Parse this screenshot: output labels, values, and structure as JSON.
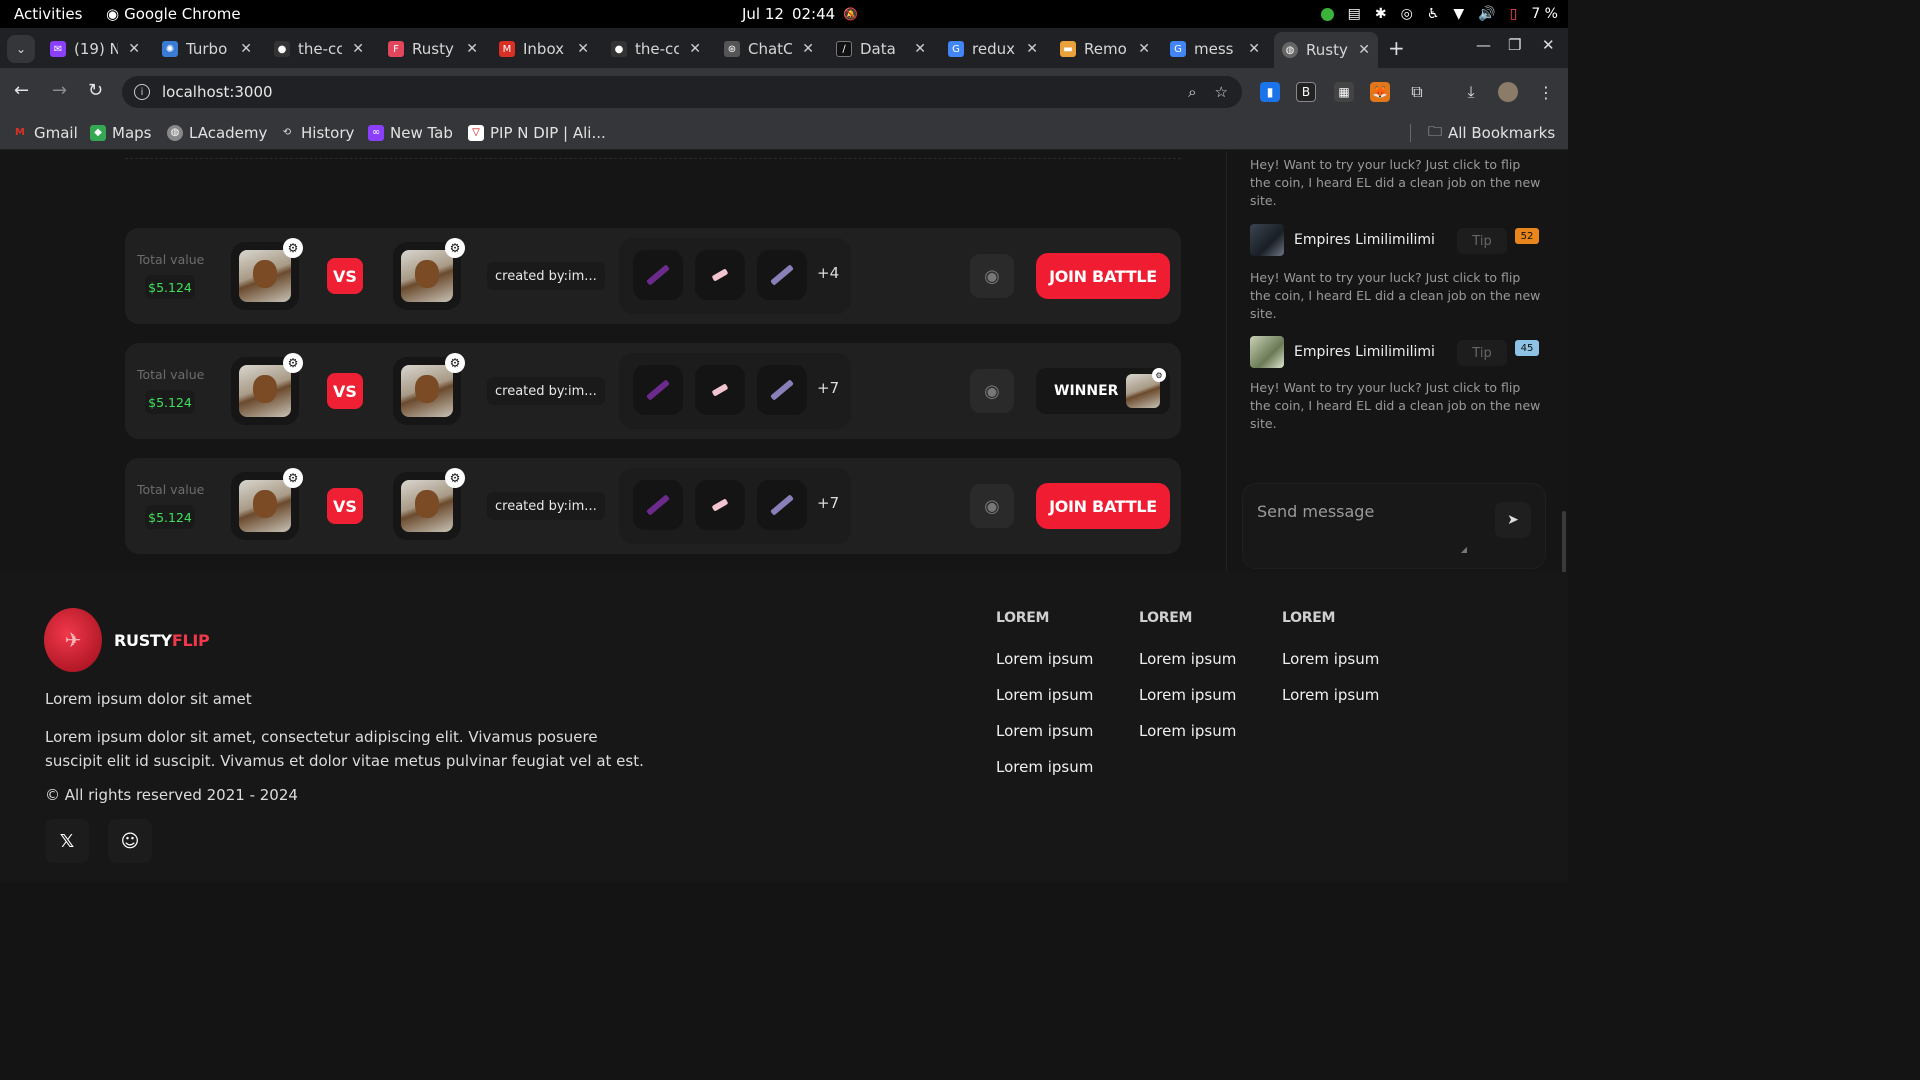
{
  "os": {
    "activities": "Activities",
    "app_name": "Google Chrome",
    "date": "Jul 12",
    "time": "02:44",
    "battery": "7 %"
  },
  "tabs": [
    {
      "label": "(19) N",
      "icon": "messenger-icon",
      "color": "#8a3ffc"
    },
    {
      "label": "Turbo",
      "icon": "turbo-icon",
      "color": "#3a7bd5"
    },
    {
      "label": "the-cc",
      "icon": "github-icon",
      "color": "#444"
    },
    {
      "label": "Rusty",
      "icon": "figma-icon",
      "color": "#e2465c"
    },
    {
      "label": "Inbox",
      "icon": "gmail-icon",
      "color": "#d93025"
    },
    {
      "label": "the-cc",
      "icon": "github-icon",
      "color": "#444"
    },
    {
      "label": "ChatC",
      "icon": "chatgpt-icon",
      "color": "#555"
    },
    {
      "label": "Data",
      "icon": "data-icon",
      "color": "#111"
    },
    {
      "label": "redux",
      "icon": "google-icon",
      "color": "#4285f4"
    },
    {
      "label": "Remo",
      "icon": "remo-icon",
      "color": "#e9a23b"
    },
    {
      "label": "mess",
      "icon": "google-icon",
      "color": "#4285f4"
    },
    {
      "label": "Rusty",
      "icon": "globe-icon",
      "color": "#666"
    }
  ],
  "address": {
    "url": "localhost:3000"
  },
  "bookmarks": [
    {
      "label": "Gmail",
      "icon": "gmail-icon"
    },
    {
      "label": "Maps",
      "icon": "maps-icon"
    },
    {
      "label": "LAcademy",
      "icon": "globe-icon"
    },
    {
      "label": "History",
      "icon": "history-icon"
    },
    {
      "label": "New Tab",
      "icon": "newtab-icon"
    },
    {
      "label": "PIP N DIP | Ali...",
      "icon": "pip-icon"
    }
  ],
  "all_bookmarks": "All Bookmarks",
  "battles": [
    {
      "total_label": "Total value",
      "total_value": "$5.124",
      "vs": "VS",
      "created": "created by:im...",
      "more": "+4",
      "action": "JOIN BATTLE"
    },
    {
      "total_label": "Total value",
      "total_value": "$5.124",
      "vs": "VS",
      "created": "created by:im...",
      "more": "+7",
      "action": "WINNER"
    },
    {
      "total_label": "Total value",
      "total_value": "$5.124",
      "vs": "VS",
      "created": "created by:im...",
      "more": "+7",
      "action": "JOIN BATTLE"
    }
  ],
  "chat": {
    "messages": [
      {
        "name": "",
        "text": "Hey! Want to try your luck? Just click to flip the coin, I heard EL did a clean job on the new site.",
        "level": ""
      },
      {
        "name": "Empires Limilimilimi",
        "tip": "Tip",
        "level": "52",
        "level_color": "#e8851c",
        "text": "Hey! Want to try your luck? Just click to flip the coin, I heard EL did a clean job on the new site."
      },
      {
        "name": "Empires Limilimilimi",
        "tip": "Tip",
        "level": "45",
        "level_color": "#8fc3e6",
        "text": "Hey! Want to try your luck? Just click to flip the coin, I heard EL did a clean job on the new site."
      }
    ],
    "send_placeholder": "Send message"
  },
  "footer": {
    "brand_main": "RUSTY",
    "brand_accent": "FLIP",
    "tagline": "Lorem ipsum dolor sit amet",
    "description": "Lorem ipsum dolor sit amet, consectetur adipiscing elit. Vivamus posuere suscipit elit id suscipit. Vivamus et dolor vitae metus pulvinar feugiat vel at est.",
    "copyright": "© All rights reserved 2021 - 2024",
    "columns": [
      {
        "heading": "LOREM",
        "links": [
          "Lorem ipsum",
          "Lorem ipsum",
          "Lorem ipsum",
          "Lorem ipsum"
        ]
      },
      {
        "heading": "LOREM",
        "links": [
          "Lorem ipsum",
          "Lorem ipsum",
          "Lorem ipsum"
        ]
      },
      {
        "heading": "LOREM",
        "links": [
          "Lorem ipsum",
          "Lorem ipsum"
        ]
      }
    ]
  }
}
